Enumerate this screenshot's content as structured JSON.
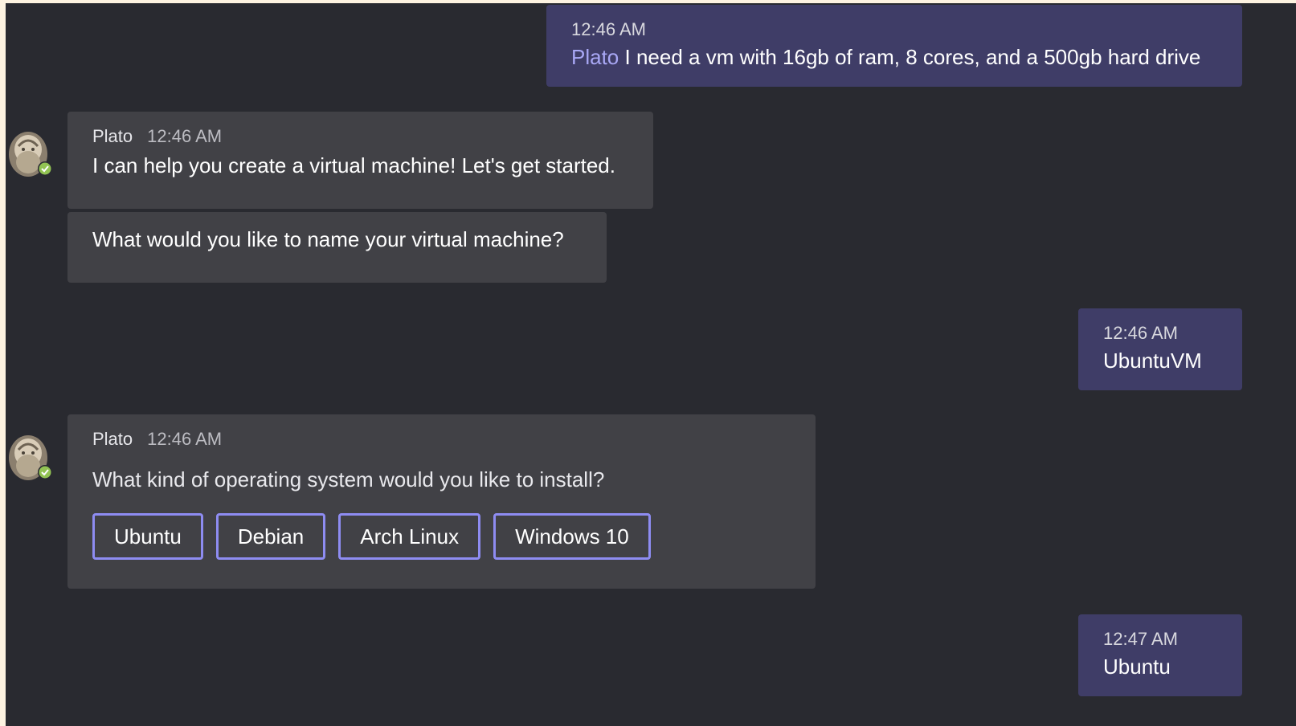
{
  "messages": {
    "m1": {
      "time": "12:46 AM",
      "mention": "Plato",
      "text": "I need a vm with 16gb of ram, 8 cores, and a 500gb hard drive"
    },
    "m2": {
      "sender": "Plato",
      "time": "12:46 AM",
      "text": "I can help you create a virtual machine! Let's get started."
    },
    "m3": {
      "text": "What would you like to name your virtual machine?"
    },
    "m4": {
      "time": "12:46 AM",
      "text": "UbuntuVM"
    },
    "m5": {
      "sender": "Plato",
      "time": "12:46 AM",
      "text": "What kind of operating system would you like to install?",
      "choices": [
        "Ubuntu",
        "Debian",
        "Arch Linux",
        "Windows 10"
      ]
    },
    "m6": {
      "time": "12:47 AM",
      "text": "Ubuntu"
    }
  },
  "colors": {
    "chat_bg": "#292a30",
    "my_bubble": "#3f3d67",
    "bot_bubble": "#414146",
    "mention": "#a9a8f5",
    "choice_border": "#8e8cf2",
    "presence": "#92c353"
  },
  "icons": {
    "avatar": "plato-bust-avatar",
    "status": "available-check-icon"
  }
}
